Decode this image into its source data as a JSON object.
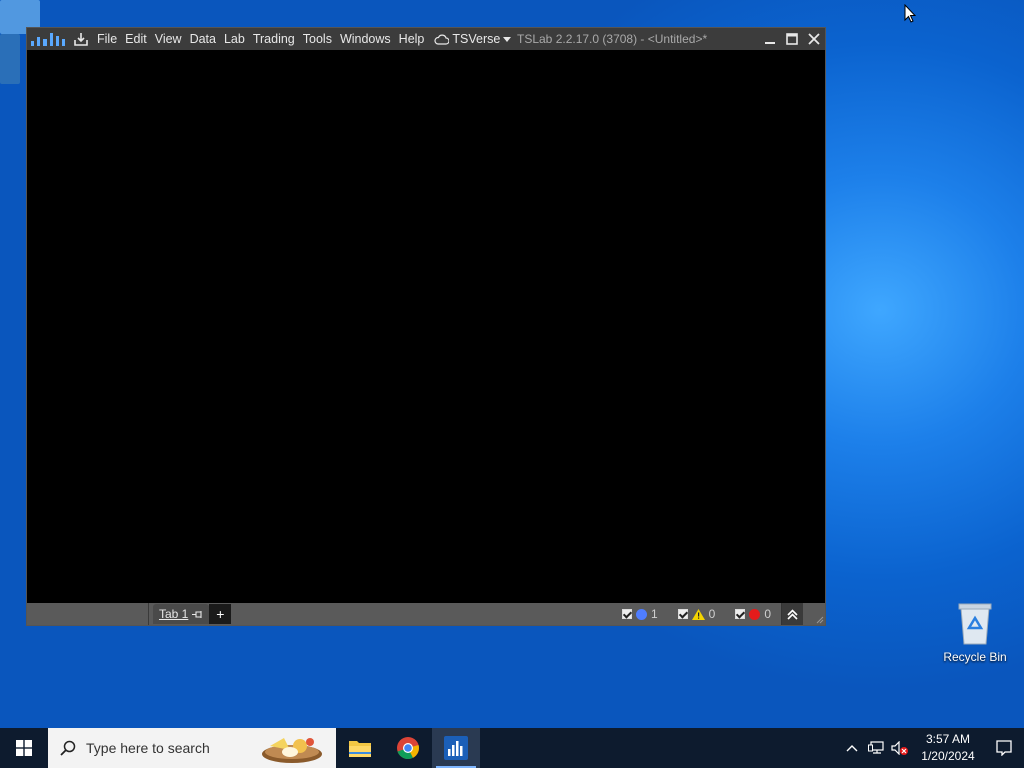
{
  "desktop": {
    "recycle_bin_label": "Recycle Bin"
  },
  "window": {
    "title": "TSLab 2.2.17.0 (3708) - <Untitled>*",
    "menu": [
      "File",
      "Edit",
      "View",
      "Data",
      "Lab",
      "Trading",
      "Tools",
      "Windows",
      "Help"
    ],
    "tsverse_label": "TSVerse",
    "accent_color": "#5aa9ff"
  },
  "statusbar": {
    "tab_label": "Tab 1",
    "add_tab_label": "+",
    "info_count": "1",
    "warning_count": "0",
    "error_count": "0"
  },
  "taskbar": {
    "search_placeholder": "Type here to search",
    "time": "3:57 AM",
    "date": "1/20/2024"
  }
}
